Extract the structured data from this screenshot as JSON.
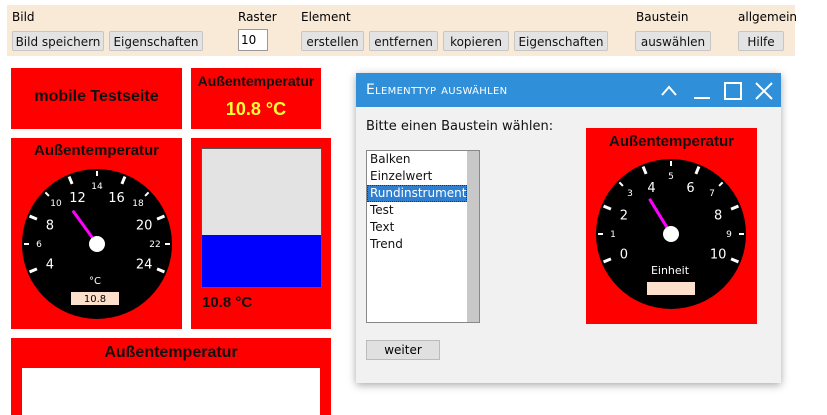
{
  "toolbar": {
    "groups": {
      "bild": "Bild",
      "raster": "Raster",
      "element": "Element",
      "baustein": "Baustein",
      "allgemein": "allgemein"
    },
    "buttons": {
      "bild_speichern": "Bild speichern",
      "bild_eigenschaften": "Eigenschaften",
      "erstellen": "erstellen",
      "entfernen": "entfernen",
      "kopieren": "kopieren",
      "element_eigenschaften": "Eigenschaften",
      "auswaehlen": "auswählen",
      "hilfe": "Hilfe"
    },
    "raster_value": "10"
  },
  "tiles": {
    "title_tile": "mobile Testseite",
    "value_tile": {
      "title": "Außentemperatur",
      "value": "10.8 °C"
    },
    "gauge_tile": {
      "title": "Außentemperatur",
      "unit": "°C",
      "readout": "10.8",
      "value": 10.8,
      "major_labels": [
        "4",
        "8",
        "12",
        "16",
        "20",
        "24"
      ],
      "minor_labels": [
        "6",
        "10",
        "14",
        "18",
        "22"
      ]
    },
    "bar_tile": {
      "value_text": "10.8 °C",
      "fill_fraction": 0.38
    },
    "bottom_tile": {
      "title": "Außentemperatur"
    }
  },
  "dialog": {
    "title": "Elementtyp auswählen",
    "prompt": "Bitte einen Baustein wählen:",
    "list_items": [
      "Balken",
      "Einzelwert",
      "Rundinstrument",
      "Test",
      "Text",
      "Trend"
    ],
    "selected": "Rundinstrument",
    "next_button": "weiter",
    "preview": {
      "title": "Außentemperatur",
      "unit": "Einheit",
      "value": 3.6,
      "major_labels": [
        "0",
        "2",
        "4",
        "6",
        "8",
        "10"
      ],
      "minor_labels": [
        "1",
        "3",
        "5",
        "7",
        "9"
      ]
    }
  },
  "colors": {
    "tile_red": "#ff0000",
    "toolbar_bg": "#f9e9d7",
    "value_yellow": "#ffff33",
    "bar_blue": "#0000ff",
    "needle_magenta": "#ff00ff",
    "dialog_title_blue": "#2f8fd8"
  }
}
